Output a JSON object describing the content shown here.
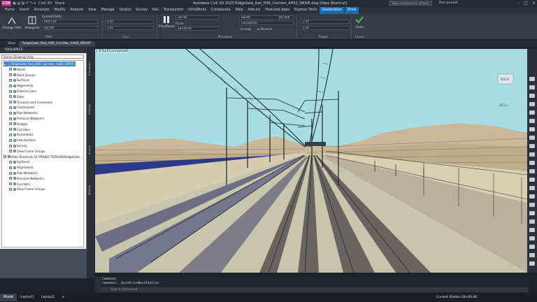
{
  "titlebar": {
    "app_badge": "C3D",
    "app_name": "Civil 3D",
    "share": "Share",
    "title": "Autodesk Civil 3D 2023   RidgeGate_Rail_HSR_Corridor_AH02_DRIVE.dwg [Data Shortcut]",
    "search_placeholder": "Type a keyword or phrase",
    "user": "Ben.wardell"
  },
  "menu_tabs": [
    "Home",
    "Insert",
    "Annotate",
    "Modify",
    "Analyze",
    "View",
    "Manage",
    "Output",
    "Survey",
    "Rail",
    "Transparent",
    "InfraWorks",
    "Collaborate",
    "Help",
    "Add-ins",
    "Featured Apps",
    "Express Tools",
    "Geolocation",
    "Drive"
  ],
  "active_tab": "Geolocation",
  "ribbon": {
    "path": {
      "change_path": "Change Path",
      "viewports": "Viewports",
      "current_paths": "Current Paths",
      "path_field1": "HSR-Corr",
      "path_field2": "SB_Rail",
      "label": "Path"
    },
    "eye": {
      "field1": "6.50",
      "field2": "5.50",
      "label": "Eye"
    },
    "navigate": {
      "play_pause": "Play/Pause",
      "go_to": "Go to",
      "field_station_a": "28+60",
      "field_station": "28+00.00",
      "field_speed": "80 mi/h",
      "speed_label": "Speed",
      "visual_style": "Conceptual",
      "loop": "Loop",
      "reverse": "Reverse",
      "label": "Navigate"
    },
    "target": {
      "field1": "3.50",
      "field2": "5.50",
      "label": "Target"
    },
    "close": {
      "label_btn": "Close",
      "label": "Close"
    }
  },
  "doc_tabs": [
    "Start",
    "RidgeGate_Rail_HSR_Corridor_AH02_DRIVE*"
  ],
  "toolspace": {
    "title": "TOOLSPACE",
    "view_select": "Active Drawing View",
    "tree": [
      {
        "label": "RidgeGate_Rail_HSR_Corridor_AH02_DRIVE",
        "level": 0,
        "selected": true
      },
      {
        "label": "Points",
        "level": 1
      },
      {
        "label": "Point Groups",
        "level": 1
      },
      {
        "label": "Surfaces",
        "level": 1
      },
      {
        "label": "Alignments",
        "level": 1
      },
      {
        "label": "Feature Lines",
        "level": 1
      },
      {
        "label": "Sites",
        "level": 1
      },
      {
        "label": "Turnouts and Crossovers",
        "level": 1
      },
      {
        "label": "Catchments",
        "level": 1
      },
      {
        "label": "Pipe Networks",
        "level": 1
      },
      {
        "label": "Pressure Networks",
        "level": 1
      },
      {
        "label": "Bridges",
        "level": 1
      },
      {
        "label": "Corridors",
        "level": 1
      },
      {
        "label": "Assemblies",
        "level": 1
      },
      {
        "label": "Intersections",
        "level": 1
      },
      {
        "label": "Survey",
        "level": 1
      },
      {
        "label": "View Frame Groups",
        "level": 1
      },
      {
        "label": "Data Shortcuts [D:\\PROJECTS\\ROAD\\RidgeGate...",
        "level": 0
      },
      {
        "label": "Surfaces",
        "level": 1
      },
      {
        "label": "Alignments",
        "level": 1
      },
      {
        "label": "Pipe Networks",
        "level": 1
      },
      {
        "label": "Pressure Networks",
        "level": 1
      },
      {
        "label": "Corridors",
        "level": 1
      },
      {
        "label": "View Frame Groups",
        "level": 1
      }
    ],
    "vertical_tabs": [
      "Prospector",
      "Settings",
      "Survey",
      "Toolbox"
    ]
  },
  "viewport": {
    "label": "[-][Top][Conceptual]",
    "viewcube": "BACK"
  },
  "command": {
    "line1": "Command:",
    "line2": "Command: _AeccDriveNextStation",
    "input_placeholder": "Type a command"
  },
  "status": {
    "tabs": [
      "Model",
      "Layout1",
      "Layout2"
    ],
    "station": "Current Station:28+60.00"
  }
}
